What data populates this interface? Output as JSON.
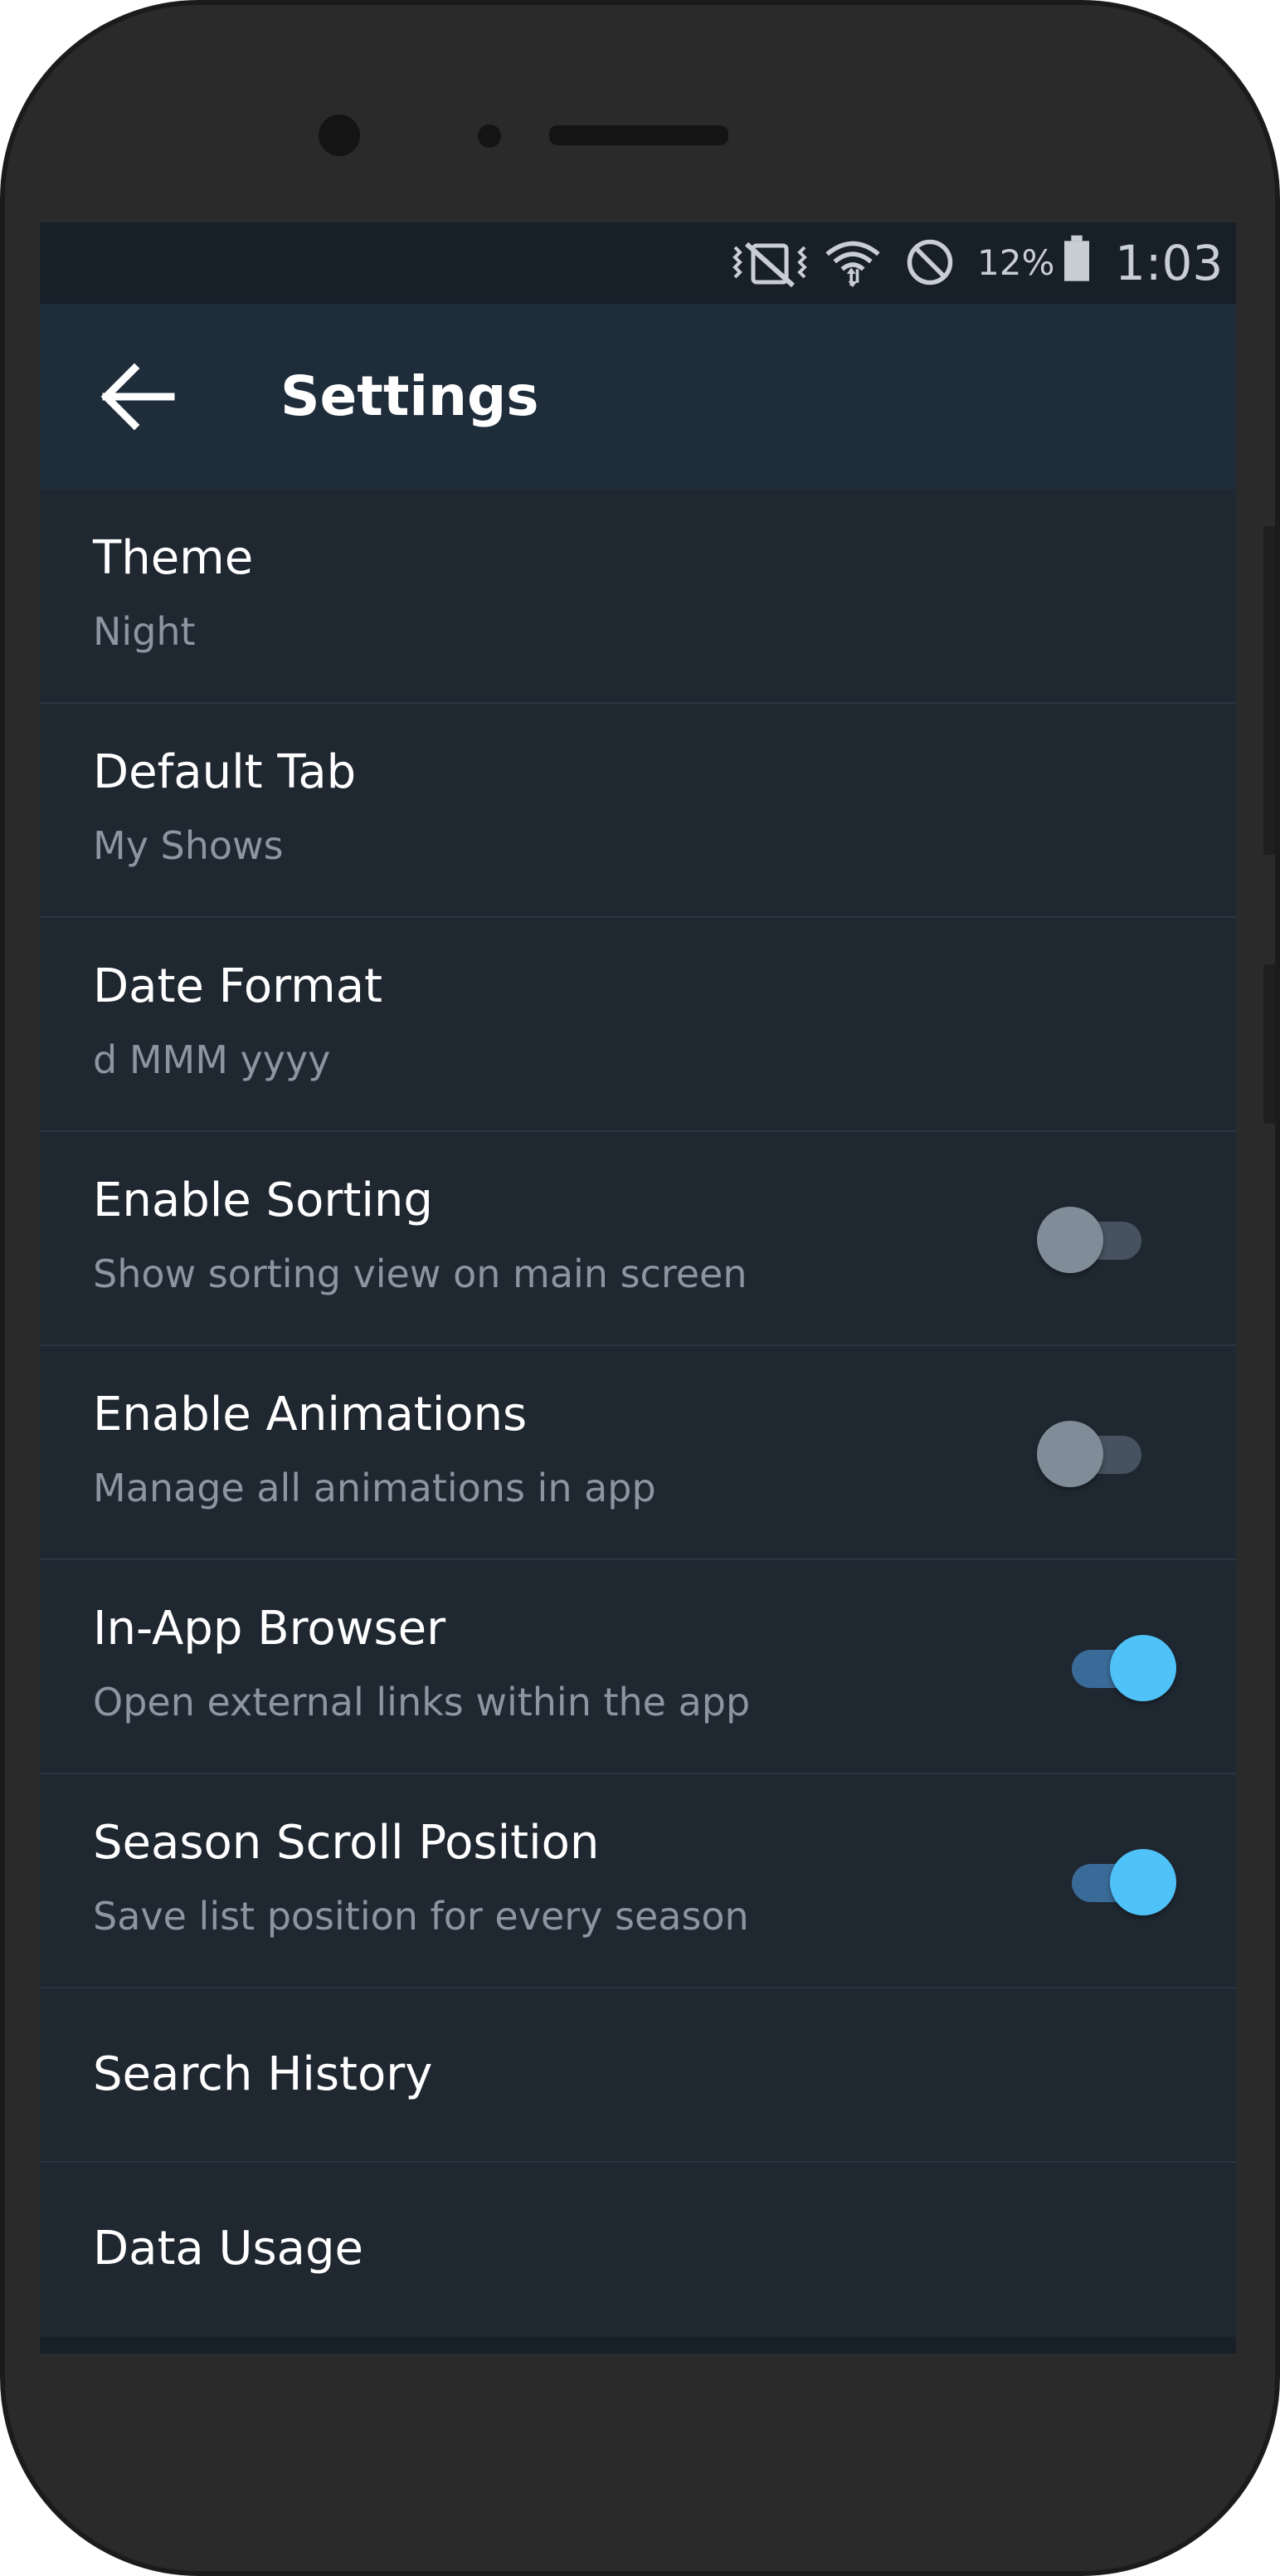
{
  "status_bar": {
    "battery_percent": "12%",
    "time": "1:03",
    "icons": [
      "vibrate-off-icon",
      "wifi-icon",
      "do-not-disturb-icon",
      "battery-icon"
    ]
  },
  "app_bar": {
    "back_icon": "arrow-left-icon",
    "title": "Settings"
  },
  "settings": {
    "theme": {
      "title": "Theme",
      "subtitle": "Night"
    },
    "default_tab": {
      "title": "Default Tab",
      "subtitle": "My Shows"
    },
    "date_format": {
      "title": "Date Format",
      "subtitle": "d MMM yyyy"
    },
    "enable_sorting": {
      "title": "Enable Sorting",
      "subtitle": "Show sorting view on main screen",
      "enabled": false
    },
    "enable_animations": {
      "title": "Enable Animations",
      "subtitle": "Manage all animations in app",
      "enabled": false
    },
    "in_app_browser": {
      "title": "In-App Browser",
      "subtitle": "Open external links within the app",
      "enabled": true
    },
    "season_scroll_position": {
      "title": "Season Scroll Position",
      "subtitle": "Save list position for every season",
      "enabled": true
    },
    "search_history": {
      "title": "Search History"
    },
    "data_usage": {
      "title": "Data Usage"
    }
  },
  "colors": {
    "accent": "#4fc3f7",
    "background": "#1f2731",
    "app_bar": "#1f2c3a",
    "status_bar": "#171f28"
  }
}
